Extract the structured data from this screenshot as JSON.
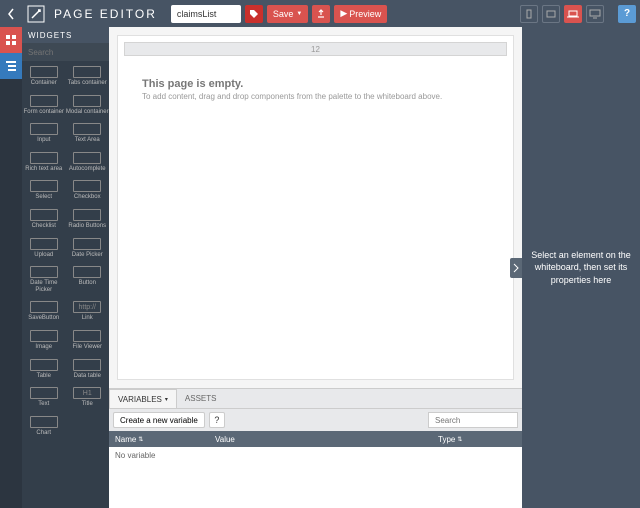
{
  "header": {
    "title": "PAGE EDITOR",
    "page_name": "claimsList",
    "save": "Save",
    "preview": "Preview"
  },
  "widgets": {
    "title": "WIDGETS",
    "search_placeholder": "Search",
    "items": [
      {
        "label": "Container"
      },
      {
        "label": "Tabs container"
      },
      {
        "label": "Form container"
      },
      {
        "label": "Modal container"
      },
      {
        "label": "Input"
      },
      {
        "label": "Text Area"
      },
      {
        "label": "Rich text area"
      },
      {
        "label": "Autocomplete"
      },
      {
        "label": "Select"
      },
      {
        "label": "Checkbox"
      },
      {
        "label": "Checklist"
      },
      {
        "label": "Radio Buttons"
      },
      {
        "label": "Upload"
      },
      {
        "label": "Date Picker"
      },
      {
        "label": "Date Time Picker"
      },
      {
        "label": "Button"
      },
      {
        "label": "SaveButton"
      },
      {
        "label": "Link"
      },
      {
        "label": "Image"
      },
      {
        "label": "File Viewer"
      },
      {
        "label": "Table"
      },
      {
        "label": "Data table"
      },
      {
        "label": "Text"
      },
      {
        "label": "Title"
      },
      {
        "label": "Chart"
      }
    ]
  },
  "canvas": {
    "ruler": "12",
    "empty_title": "This page is empty.",
    "empty_sub": "To add content, drag and drop components from the palette to the whiteboard above."
  },
  "variables": {
    "tabs": {
      "variables": "VARIABLES",
      "assets": "ASSETS"
    },
    "create": "Create a new variable",
    "search_placeholder": "Search",
    "cols": {
      "name": "Name",
      "value": "Value",
      "type": "Type"
    },
    "empty": "No variable"
  },
  "properties": {
    "placeholder": "Select an element on the whiteboard, then set its properties here"
  },
  "icons": {
    "link": "http://",
    "title": "H1"
  }
}
